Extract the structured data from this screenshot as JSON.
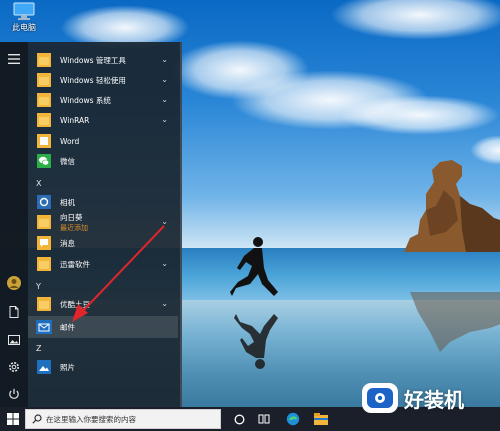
{
  "desktop": {
    "icon_label": "此电脑"
  },
  "start_menu": {
    "groups": [
      {
        "letter": null,
        "items": [
          {
            "name": "Windows 管理工具",
            "tile": "folder",
            "chevron": true
          },
          {
            "name": "Windows 轻松使用",
            "tile": "folder",
            "chevron": true
          },
          {
            "name": "Windows 系统",
            "tile": "folder",
            "chevron": true
          },
          {
            "name": "WinRAR",
            "tile": "folder",
            "chevron": true
          },
          {
            "name": "Word",
            "tile": "word",
            "chevron": false
          },
          {
            "name": "微信",
            "tile": "wechat",
            "chevron": false
          }
        ]
      },
      {
        "letter": "X",
        "items": [
          {
            "name": "相机",
            "tile": "camera",
            "chevron": false
          },
          {
            "name": "向日葵",
            "sub": "最近添加",
            "tile": "folder",
            "chevron": true
          },
          {
            "name": "消息",
            "tile": "message",
            "chevron": false
          },
          {
            "name": "迅雷软件",
            "tile": "folder",
            "chevron": true
          }
        ]
      },
      {
        "letter": "Y",
        "items": [
          {
            "name": "优酷土豆",
            "tile": "folder",
            "chevron": true
          },
          {
            "name": "邮件",
            "tile": "mail",
            "chevron": false,
            "highlighted": true
          }
        ]
      },
      {
        "letter": "Z",
        "items": [
          {
            "name": "照片",
            "tile": "photos",
            "chevron": false
          }
        ]
      }
    ]
  },
  "taskbar": {
    "search_placeholder": "在这里输入你要搜索的内容"
  },
  "watermark": {
    "text": "好装机"
  },
  "colors": {
    "folder": "#f2b53a",
    "accent": "#1f6fbf",
    "wechat": "#2aae45",
    "arrow": "#e0262b"
  }
}
